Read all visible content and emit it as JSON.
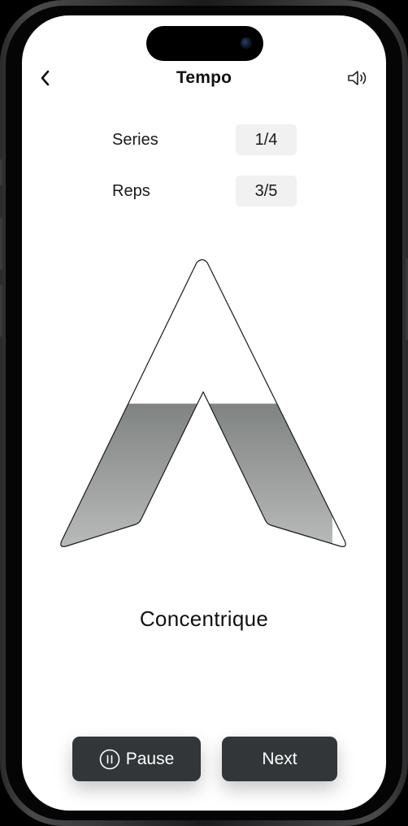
{
  "header": {
    "title": "Tempo",
    "back_icon": "chevron-left-icon",
    "sound_icon": "speaker-icon"
  },
  "stats": {
    "series": {
      "label": "Series",
      "value": "1/4"
    },
    "reps": {
      "label": "Reps",
      "value": "3/5"
    }
  },
  "tempo_indicator": {
    "fill_level": 0.5,
    "fill_color_top": "#7f8382",
    "fill_color_bottom": "#bbbcbc"
  },
  "phase": {
    "label": "Concentrique"
  },
  "controls": {
    "pause_label": "Pause",
    "pause_icon": "pause-circle-icon",
    "next_label": "Next"
  },
  "colors": {
    "button_bg": "#323638",
    "value_chip_bg": "#f1f1f1"
  }
}
